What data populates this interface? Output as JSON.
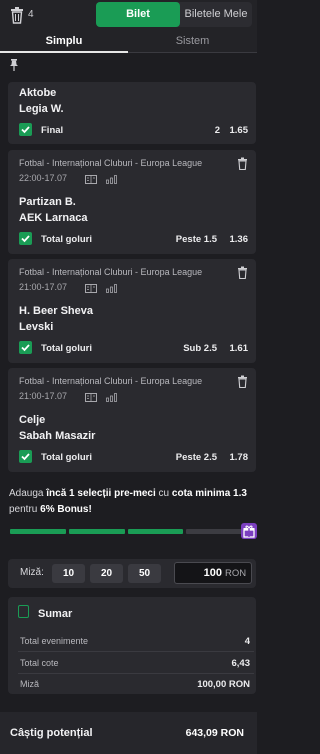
{
  "header": {
    "selection_count": "4",
    "tab_bilet": "Bilet",
    "tab_mele": "Biletele Mele"
  },
  "subtabs": {
    "simplu": "Simplu",
    "sistem": "Sistem"
  },
  "bets": [
    {
      "league": "",
      "datetime": "",
      "home": "Aktobe",
      "away": "Legia W.",
      "market": "Final",
      "selection": "2",
      "odd": "1.65"
    },
    {
      "league": "Fotbal - Internațional Cluburi - Europa League",
      "datetime": "22:00-17.07",
      "home": "Partizan B.",
      "away": "AEK Larnaca",
      "market": "Total goluri",
      "selection": "Peste 1.5",
      "odd": "1.36"
    },
    {
      "league": "Fotbal - Internațional Cluburi - Europa League",
      "datetime": "21:00-17.07",
      "home": "H. Beer Sheva",
      "away": "Levski",
      "market": "Total goluri",
      "selection": "Sub 2.5",
      "odd": "1.61"
    },
    {
      "league": "Fotbal - Internațional Cluburi - Europa League",
      "datetime": "21:00-17.07",
      "home": "Celje",
      "away": "Sabah Masazir",
      "market": "Total goluri",
      "selection": "Peste 2.5",
      "odd": "1.78"
    }
  ],
  "bonus": {
    "pre": "Adauga ",
    "count": "încă 1 selecții pre-meci",
    "mid": " cu ",
    "min_odd_label": "cota minima 1.3",
    "for": " pentru ",
    "bonus_pct": "6% Bonus!",
    "filled_segments": 3,
    "total_segments": 4
  },
  "stake": {
    "label": "Miză:",
    "quick": [
      "10",
      "20",
      "50"
    ],
    "value": "100",
    "currency": "RON"
  },
  "summary": {
    "title": "Sumar",
    "rows": [
      {
        "label": "Total evenimente",
        "value": "4"
      },
      {
        "label": "Total cote",
        "value": "6,43"
      },
      {
        "label": "Miză",
        "value": "100,00 RON"
      }
    ]
  },
  "potential": {
    "label": "Câștig potențial",
    "value": "643,09 RON"
  },
  "colors": {
    "accent": "#1a9c55",
    "gift": "#7b3fbf",
    "background": "#1d1d21",
    "card": "#2a2a2f"
  },
  "icons": [
    "trash-icon",
    "pin-icon",
    "stats-icon",
    "bars-icon",
    "check-icon",
    "gift-icon",
    "summary-icon"
  ]
}
